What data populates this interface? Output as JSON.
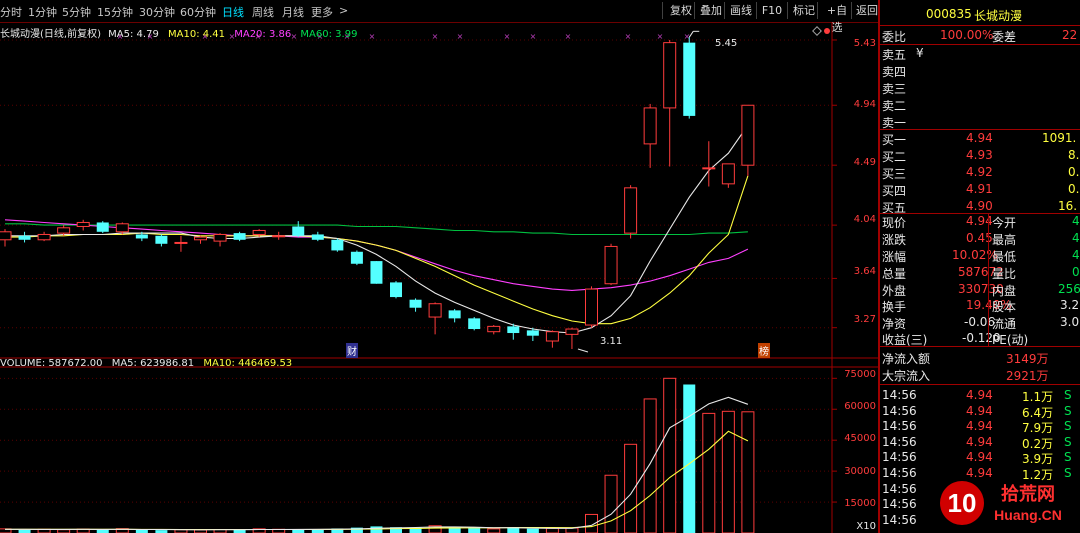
{
  "toolbar": {
    "periods": [
      "分时",
      "1分钟",
      "5分钟",
      "15分钟",
      "30分钟",
      "60分钟",
      "日线",
      "周线",
      "月线",
      "更多"
    ],
    "active_period": "日线",
    "more_arrow": ">",
    "buttons": [
      "复权",
      "叠加",
      "画线",
      "F10",
      "标记",
      "+自选",
      "返回"
    ]
  },
  "chart": {
    "title": "长城动漫(日线,前复权)",
    "ma_legend": [
      {
        "label": "MA5: 4.79",
        "color": "#e8e8e8"
      },
      {
        "label": "MA10: 4.41",
        "color": "#ffff40"
      },
      {
        "label": "MA20: 3.86",
        "color": "#ff40ff"
      },
      {
        "label": "MA60: 3.99",
        "color": "#00e050"
      }
    ],
    "price_axis": [
      "5.43",
      "4.94",
      "4.49",
      "4.04",
      "3.64",
      "3.27"
    ],
    "high_label": "5.45",
    "low_label": "3.11",
    "marker_cai": "财",
    "marker_bang": "榜",
    "volume_legend": [
      {
        "label": "VOLUME: 587672.00",
        "color": "#e8e8e8"
      },
      {
        "label": "MA5: 623986.81",
        "color": "#e8e8e8"
      },
      {
        "label": "MA10: 446469.53",
        "color": "#ffff40"
      }
    ],
    "volume_axis": [
      "75000",
      "60000",
      "45000",
      "30000",
      "15000"
    ],
    "volume_unit": "X10"
  },
  "chart_data": {
    "type": "candlestick",
    "candles": [
      {
        "o": 3.93,
        "c": 3.99,
        "h": 4.01,
        "l": 3.88
      },
      {
        "o": 3.96,
        "c": 3.93,
        "h": 3.99,
        "l": 3.91
      },
      {
        "o": 3.93,
        "c": 3.97,
        "h": 3.99,
        "l": 3.92
      },
      {
        "o": 3.98,
        "c": 4.02,
        "h": 4.04,
        "l": 3.96
      },
      {
        "o": 4.03,
        "c": 4.06,
        "h": 4.08,
        "l": 4.0
      },
      {
        "o": 4.06,
        "c": 3.99,
        "h": 4.07,
        "l": 3.98
      },
      {
        "o": 3.99,
        "c": 4.05,
        "h": 4.06,
        "l": 3.97
      },
      {
        "o": 3.97,
        "c": 3.94,
        "h": 3.99,
        "l": 3.92
      },
      {
        "o": 3.96,
        "c": 3.9,
        "h": 3.97,
        "l": 3.88
      },
      {
        "o": 3.91,
        "c": 3.91,
        "h": 3.96,
        "l": 3.84
      },
      {
        "o": 3.93,
        "c": 3.95,
        "h": 3.96,
        "l": 3.9
      },
      {
        "o": 3.92,
        "c": 3.97,
        "h": 3.98,
        "l": 3.88
      },
      {
        "o": 3.98,
        "c": 3.93,
        "h": 3.99,
        "l": 3.92
      },
      {
        "o": 3.97,
        "c": 4.0,
        "h": 4.01,
        "l": 3.95
      },
      {
        "o": 3.96,
        "c": 3.96,
        "h": 3.99,
        "l": 3.93
      },
      {
        "o": 4.03,
        "c": 3.96,
        "h": 4.07,
        "l": 3.95
      },
      {
        "o": 3.97,
        "c": 3.93,
        "h": 3.99,
        "l": 3.92
      },
      {
        "o": 3.93,
        "c": 3.85,
        "h": 3.94,
        "l": 3.84
      },
      {
        "o": 3.84,
        "c": 3.75,
        "h": 3.85,
        "l": 3.74
      },
      {
        "o": 3.77,
        "c": 3.6,
        "h": 3.77,
        "l": 3.6
      },
      {
        "o": 3.61,
        "c": 3.5,
        "h": 3.62,
        "l": 3.49
      },
      {
        "o": 3.48,
        "c": 3.42,
        "h": 3.49,
        "l": 3.39
      },
      {
        "o": 3.35,
        "c": 3.45,
        "h": 3.46,
        "l": 3.22
      },
      {
        "o": 3.4,
        "c": 3.34,
        "h": 3.41,
        "l": 3.31
      },
      {
        "o": 3.34,
        "c": 3.26,
        "h": 3.35,
        "l": 3.25
      },
      {
        "o": 3.24,
        "c": 3.28,
        "h": 3.29,
        "l": 3.22
      },
      {
        "o": 3.28,
        "c": 3.23,
        "h": 3.3,
        "l": 3.18
      },
      {
        "o": 3.25,
        "c": 3.21,
        "h": 3.27,
        "l": 3.17
      },
      {
        "o": 3.17,
        "c": 3.24,
        "h": 3.25,
        "l": 3.12
      },
      {
        "o": 3.22,
        "c": 3.26,
        "h": 3.27,
        "l": 3.11
      },
      {
        "o": 3.29,
        "c": 3.56,
        "h": 3.58,
        "l": 3.27
      },
      {
        "o": 3.6,
        "c": 3.88,
        "h": 3.9,
        "l": 3.59
      },
      {
        "o": 3.98,
        "c": 4.32,
        "h": 4.34,
        "l": 3.94
      },
      {
        "o": 4.65,
        "c": 4.92,
        "h": 4.95,
        "l": 4.47
      },
      {
        "o": 4.92,
        "c": 5.41,
        "h": 5.43,
        "l": 4.48
      },
      {
        "o": 5.41,
        "c": 4.86,
        "h": 5.45,
        "l": 4.84
      },
      {
        "o": 4.47,
        "c": 4.47,
        "h": 4.67,
        "l": 4.33
      },
      {
        "o": 4.35,
        "c": 4.5,
        "h": 4.5,
        "l": 4.32
      },
      {
        "o": 4.49,
        "c": 4.94,
        "h": 4.94,
        "l": 4.41
      }
    ],
    "ma5": [
      3.96,
      3.96,
      3.96,
      3.97,
      3.97,
      3.97,
      3.98,
      3.98,
      3.98,
      3.98,
      3.95,
      3.94,
      3.94,
      3.95,
      3.96,
      3.96,
      3.96,
      3.94,
      3.89,
      3.82,
      3.73,
      3.62,
      3.53,
      3.46,
      3.4,
      3.34,
      3.29,
      3.26,
      3.24,
      3.23,
      3.27,
      3.36,
      3.51,
      3.77,
      4.01,
      4.25,
      4.45,
      4.58,
      4.79
    ],
    "ma10": [
      3.95,
      3.95,
      3.96,
      3.96,
      3.97,
      3.97,
      3.97,
      3.98,
      3.97,
      3.97,
      3.96,
      3.96,
      3.96,
      3.96,
      3.96,
      3.96,
      3.95,
      3.94,
      3.92,
      3.89,
      3.85,
      3.79,
      3.73,
      3.66,
      3.59,
      3.53,
      3.47,
      3.41,
      3.36,
      3.32,
      3.3,
      3.3,
      3.34,
      3.42,
      3.53,
      3.66,
      3.83,
      3.97,
      4.41
    ],
    "ma20": [
      4.08,
      4.07,
      4.06,
      4.05,
      4.04,
      4.03,
      4.02,
      4.01,
      4.0,
      3.99,
      3.98,
      3.97,
      3.96,
      3.96,
      3.96,
      3.95,
      3.95,
      3.94,
      3.92,
      3.89,
      3.85,
      3.8,
      3.75,
      3.7,
      3.66,
      3.63,
      3.6,
      3.58,
      3.56,
      3.55,
      3.56,
      3.57,
      3.59,
      3.62,
      3.66,
      3.71,
      3.76,
      3.79,
      3.86
    ],
    "ma60": [
      4.05,
      4.05,
      4.04,
      4.04,
      4.04,
      4.04,
      4.04,
      4.04,
      4.04,
      4.04,
      4.04,
      4.04,
      4.04,
      4.04,
      4.04,
      4.04,
      4.04,
      4.04,
      4.03,
      4.03,
      4.03,
      4.02,
      4.01,
      4.0,
      4.0,
      3.99,
      3.99,
      3.98,
      3.98,
      3.97,
      3.97,
      3.97,
      3.97,
      3.97,
      3.97,
      3.97,
      3.98,
      3.98,
      3.99
    ],
    "volume": [
      2000,
      1500,
      1800,
      1600,
      1900,
      1700,
      2100,
      1500,
      1400,
      1600,
      1500,
      1700,
      1600,
      2000,
      1800,
      1700,
      1600,
      2200,
      2600,
      3200,
      2800,
      2600,
      3500,
      2800,
      2400,
      2000,
      2600,
      2100,
      2300,
      2400,
      9000,
      28000,
      43000,
      65000,
      75000,
      72000,
      58000,
      59000,
      58767
    ],
    "vol_ma5": [
      1800,
      1800,
      1750,
      1760,
      1800,
      1750,
      1800,
      1700,
      1700,
      1620,
      1560,
      1580,
      1620,
      1680,
      1720,
      1760,
      1780,
      1860,
      2000,
      2260,
      2480,
      2680,
      2940,
      2980,
      2820,
      2520,
      2580,
      2380,
      2280,
      2280,
      3680,
      9100,
      18800,
      33600,
      51000,
      56600,
      62600,
      65800,
      62398
    ],
    "vol_ma10": [
      1800,
      1800,
      1780,
      1780,
      1780,
      1770,
      1780,
      1760,
      1740,
      1720,
      1700,
      1690,
      1680,
      1690,
      1700,
      1700,
      1720,
      1760,
      1830,
      1960,
      2120,
      2240,
      2400,
      2480,
      2500,
      2500,
      2600,
      2660,
      2630,
      2560,
      3110,
      5890,
      10800,
      18200,
      26900,
      33600,
      40600,
      49300,
      44647
    ],
    "price_ylim": [
      3.05,
      5.55
    ],
    "vol_ylim": [
      0,
      80000
    ]
  },
  "panel": {
    "code": "000835",
    "name": "长城动漫",
    "weibi_label": "委比",
    "weibi_value": "100.00%",
    "weicha_label": "委差",
    "weicha_value": "22",
    "sell": [
      {
        "label": "卖五",
        "price": "",
        "vol": "",
        "extra": "¥"
      },
      {
        "label": "卖四",
        "price": "",
        "vol": ""
      },
      {
        "label": "卖三",
        "price": "",
        "vol": ""
      },
      {
        "label": "卖二",
        "price": "",
        "vol": ""
      },
      {
        "label": "卖一",
        "price": "",
        "vol": ""
      }
    ],
    "buy": [
      {
        "label": "买一",
        "price": "4.94",
        "vol": "1091."
      },
      {
        "label": "买二",
        "price": "4.93",
        "vol": "8."
      },
      {
        "label": "买三",
        "price": "4.92",
        "vol": "0."
      },
      {
        "label": "买四",
        "price": "4.91",
        "vol": "0."
      },
      {
        "label": "买五",
        "price": "4.90",
        "vol": "16."
      }
    ],
    "quote": [
      {
        "l1": "现价",
        "v1": "4.94",
        "l2": "今开",
        "v2": "4"
      },
      {
        "l1": "涨跌",
        "v1": "0.45",
        "l2": "最高",
        "v2": "4"
      },
      {
        "l1": "涨幅",
        "v1": "10.02%",
        "l2": "最低",
        "v2": "4"
      },
      {
        "l1": "总量",
        "v1": "587672",
        "l2": "量比",
        "v2": "0"
      },
      {
        "l1": "外盘",
        "v1": "330730",
        "l2": "内盘",
        "v2": "256"
      },
      {
        "l1": "换手",
        "v1": "19.40%",
        "l2": "股本",
        "v2": "3.2"
      },
      {
        "l1": "净资",
        "v1": "-0.06",
        "l2": "流通",
        "v2": "3.0"
      },
      {
        "l1": "收益(三)",
        "v1": "-0.120",
        "l2": "PE(动)",
        "v2": ""
      }
    ],
    "flow": [
      {
        "label": "净流入额",
        "value": "3149万"
      },
      {
        "label": "大宗流入",
        "value": "2921万"
      }
    ],
    "ticks": [
      {
        "time": "14:56",
        "price": "4.94",
        "vol": "1.1万",
        "side": "S"
      },
      {
        "time": "14:56",
        "price": "4.94",
        "vol": "6.4万",
        "side": "S"
      },
      {
        "time": "14:56",
        "price": "4.94",
        "vol": "7.9万",
        "side": "S"
      },
      {
        "time": "14:56",
        "price": "4.94",
        "vol": "0.2万",
        "side": "S"
      },
      {
        "time": "14:56",
        "price": "4.94",
        "vol": "3.9万",
        "side": "S"
      },
      {
        "time": "14:56",
        "price": "4.94",
        "vol": "1.2万",
        "side": "S"
      },
      {
        "time": "14:56",
        "price": "",
        "vol": "",
        "side": ""
      },
      {
        "time": "14:56",
        "price": "",
        "vol": "",
        "side": ""
      },
      {
        "time": "14:56",
        "price": "",
        "vol": "",
        "side": ""
      }
    ],
    "watermark_text": "拾荒网",
    "watermark_num": "10",
    "watermark_url": "Huang.CN"
  }
}
